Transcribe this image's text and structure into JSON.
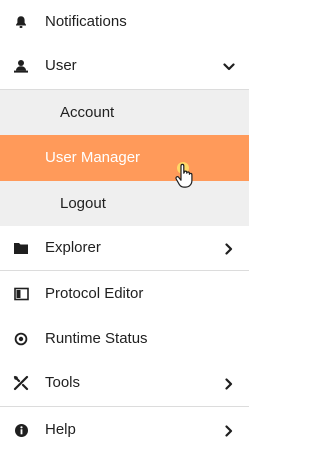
{
  "menu": {
    "notifications": {
      "label": "Notifications",
      "icon": "bell-icon"
    },
    "user": {
      "label": "User",
      "icon": "user-monitor-icon",
      "expanded": true,
      "submenu": [
        {
          "label": "Account"
        },
        {
          "label": "User Manager",
          "active": true
        },
        {
          "label": "Logout"
        }
      ]
    },
    "explorer": {
      "label": "Explorer",
      "icon": "folder-icon"
    },
    "protocol_editor": {
      "label": "Protocol Editor",
      "icon": "panel-layout-icon"
    },
    "runtime_status": {
      "label": "Runtime Status",
      "icon": "target-icon"
    },
    "tools": {
      "label": "Tools",
      "icon": "tools-icon"
    },
    "help": {
      "label": "Help",
      "icon": "info-icon"
    }
  },
  "colors": {
    "active_bg": "#ff9a5a",
    "submenu_bg": "#efefef",
    "divider": "#dcdcdc"
  }
}
